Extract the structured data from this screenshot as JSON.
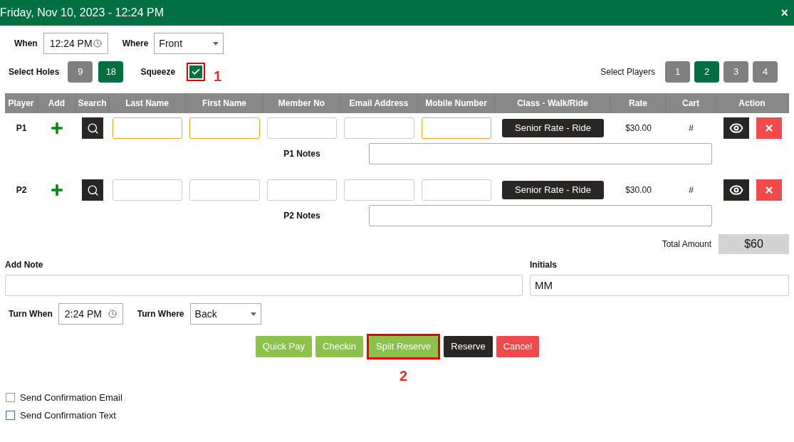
{
  "window": {
    "title": "Friday, Nov 10, 2023 - 12:24 PM",
    "close": "×"
  },
  "when": {
    "label": "When",
    "value": "12:24 PM"
  },
  "where": {
    "label": "Where",
    "value": "Front"
  },
  "holes": {
    "label": "Select Holes",
    "options": [
      {
        "label": "9",
        "selected": false
      },
      {
        "label": "18",
        "selected": true
      }
    ]
  },
  "squeeze": {
    "label": "Squeeze",
    "checked": true,
    "callout": "1"
  },
  "players_select": {
    "label": "Select Players",
    "options": [
      {
        "label": "1",
        "selected": false
      },
      {
        "label": "2",
        "selected": true
      },
      {
        "label": "3",
        "selected": false
      },
      {
        "label": "4",
        "selected": false
      }
    ]
  },
  "table": {
    "columns": [
      "Player",
      "Add",
      "Search",
      "Last Name",
      "First Name",
      "Member No",
      "Email Address",
      "Mobile Number",
      "Class - Walk/Ride",
      "Rate",
      "Cart",
      "Action"
    ],
    "rows": [
      {
        "player": "P1",
        "fields": [
          {
            "highlighted": true
          },
          {
            "highlighted": true
          },
          {
            "highlighted": false
          },
          {
            "highlighted": false
          },
          {
            "highlighted": true
          }
        ],
        "class": "Senior Rate - Ride",
        "rate": "$30.00",
        "cart": "#",
        "notes_label": "P1 Notes"
      },
      {
        "player": "P2",
        "fields": [
          {
            "highlighted": false
          },
          {
            "highlighted": false
          },
          {
            "highlighted": false
          },
          {
            "highlighted": false
          },
          {
            "highlighted": false
          }
        ],
        "class": "Senior Rate - Ride",
        "rate": "$30.00",
        "cart": "#",
        "notes_label": "P2 Notes"
      }
    ]
  },
  "total": {
    "label": "Total Amount",
    "value": "$60"
  },
  "add_note": {
    "label": "Add Note"
  },
  "initials": {
    "label": "Initials",
    "value": "MM"
  },
  "turn_when": {
    "label": "Turn When",
    "value": "2:24 PM"
  },
  "turn_where": {
    "label": "Turn Where",
    "value": "Back"
  },
  "actions": [
    {
      "label": "Quick Pay",
      "kind": "green"
    },
    {
      "label": "Checkin",
      "kind": "green"
    },
    {
      "label": "Split Reserve",
      "kind": "green",
      "callout": "2"
    },
    {
      "label": "Reserve",
      "kind": "dark"
    },
    {
      "label": "Cancel",
      "kind": "red"
    }
  ],
  "confirmations": [
    {
      "label": "Send Confirmation Email",
      "checked": false,
      "focused": false
    },
    {
      "label": "Send Confirmation Text",
      "checked": false,
      "focused": true
    }
  ]
}
